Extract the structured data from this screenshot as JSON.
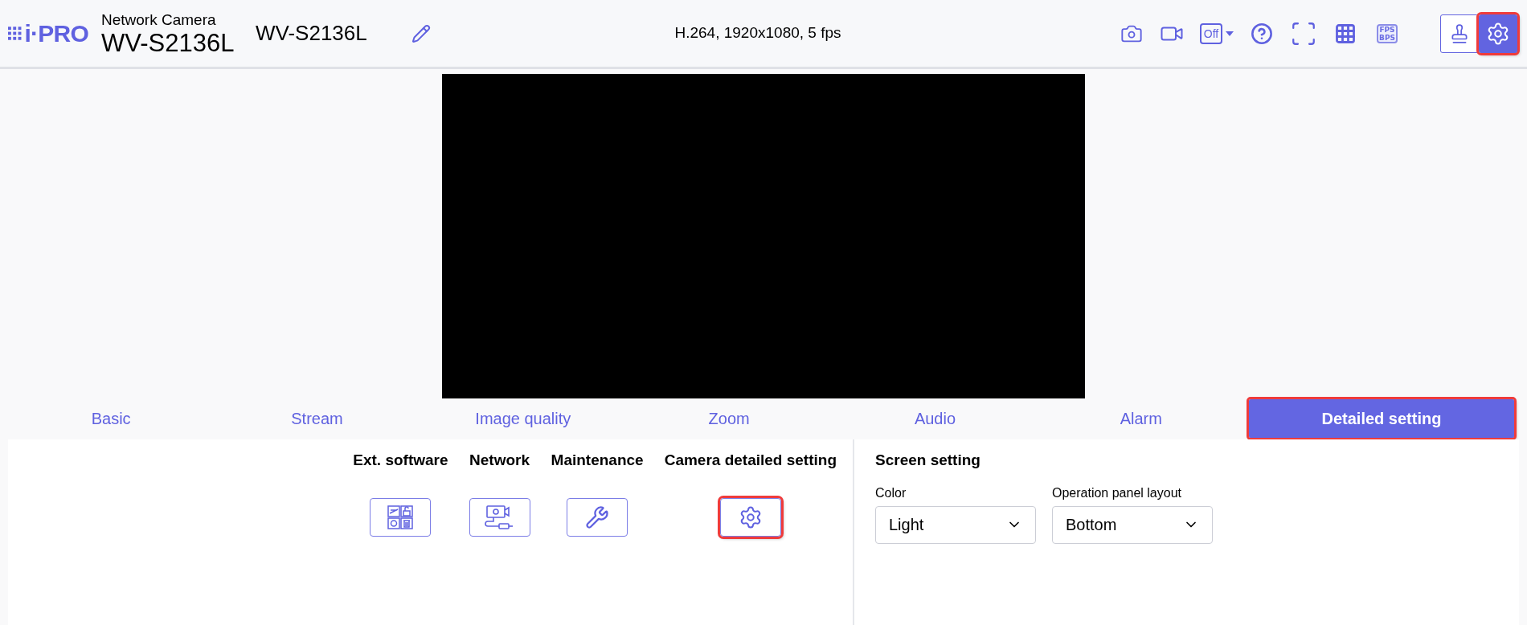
{
  "header": {
    "logo": "i·PRO",
    "product_type": "Network Camera",
    "model": "WV-S2136L",
    "camera_name": "WV-S2136L",
    "stream_info": "H.264, 1920x1080, 5 fps"
  },
  "toolbar": [
    {
      "kind": "snapshot",
      "highlighted": false
    },
    {
      "kind": "record",
      "highlighted": false
    },
    {
      "kind": "off",
      "label": "Off",
      "highlighted": false
    },
    {
      "kind": "help",
      "highlighted": false
    },
    {
      "kind": "fullscreen",
      "highlighted": false
    },
    {
      "kind": "grid",
      "highlighted": false
    },
    {
      "kind": "fps",
      "label": "FPS",
      "label2": "BPS",
      "highlighted": false
    }
  ],
  "mode_buttons": [
    {
      "kind": "operate",
      "selected": false,
      "highlighted": false
    },
    {
      "kind": "settings",
      "selected": true,
      "highlighted": true
    }
  ],
  "tabs": [
    {
      "label": "Basic",
      "selected": false,
      "highlighted": false
    },
    {
      "label": "Stream",
      "selected": false,
      "highlighted": false
    },
    {
      "label": "Image quality",
      "selected": false,
      "highlighted": false
    },
    {
      "label": "Zoom",
      "selected": false,
      "highlighted": false
    },
    {
      "label": "Audio",
      "selected": false,
      "highlighted": false
    },
    {
      "label": "Alarm",
      "selected": false,
      "highlighted": false
    },
    {
      "label": "Detailed setting",
      "selected": true,
      "highlighted": true
    }
  ],
  "detailed_items": [
    {
      "label": "Ext. software",
      "kind": "ext",
      "highlighted": false
    },
    {
      "label": "Network",
      "kind": "network",
      "highlighted": false
    },
    {
      "label": "Maintenance",
      "kind": "maintenance",
      "highlighted": false
    },
    {
      "label": "Camera detailed setting",
      "kind": "camera",
      "highlighted": true
    }
  ],
  "screen_setting": {
    "title": "Screen setting",
    "fields": [
      {
        "label": "Color",
        "value": "Light"
      },
      {
        "label": "Operation panel layout",
        "value": "Bottom"
      }
    ]
  }
}
